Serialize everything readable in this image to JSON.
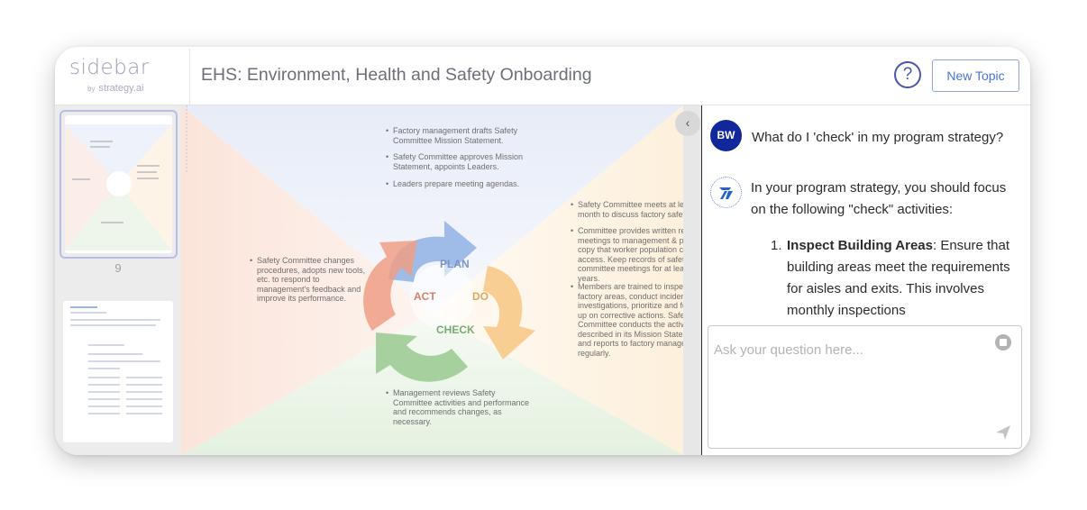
{
  "app": {
    "logo_main": "sidebar",
    "logo_by": "by",
    "logo_sub": "strategy.ai",
    "title": "EHS: Environment, Health and Safety Onboarding",
    "help_icon": "?",
    "new_topic_label": "New Topic"
  },
  "thumbnails": {
    "page_label": "9"
  },
  "document": {
    "top_bullets": [
      "Factory management drafts Safety Committee Mission Statement.",
      "Safety Committee approves Mission Statement, appoints Leaders.",
      "Leaders prepare meeting agendas."
    ],
    "right_bullets": [
      "Safety Committee meets at least once a month to discuss factory safety issues.",
      "Committee provides written record of meetings to management & posts a copy that worker population can easily access. Keep records of safety committee meetings for at least five years.",
      "Members are trained to inspect factory areas, conduct incident investigations, prioritize and follow-up on corrective actions. Safety Committee conducts the activities described in its Mission Statement and reports to factory management regularly."
    ],
    "left_bullets": [
      "Safety Committee changes procedures, adopts new tools, etc. to respond to management's feedback and improve its performance."
    ],
    "bottom_bullets": [
      "Management reviews Safety Committee activities and performance and recommends changes, as necessary."
    ],
    "cycle": {
      "plan": "PLAN",
      "do": "DO",
      "check": "CHECK",
      "act": "ACT"
    },
    "colors": {
      "plan": "#8fb2e3",
      "do": "#f7c98a",
      "check": "#9dcc96",
      "act": "#ef9f85"
    }
  },
  "viewer_controls": {
    "collapse_icon": "‹",
    "target_icon": "⌖",
    "zoom_in": "+",
    "zoom_out": "−"
  },
  "chat": {
    "user_initials": "BW",
    "user_message": "What do I 'check' in my program strategy?",
    "bot_message": "In your program strategy, you should focus on the following \"check\" activities:",
    "list_number": "1.",
    "list_item_title": "Inspect Building Areas",
    "list_item_text": ": Ensure that building areas meet the requirements for aisles and exits. This involves monthly inspections",
    "input_placeholder": "Ask your question here..."
  }
}
